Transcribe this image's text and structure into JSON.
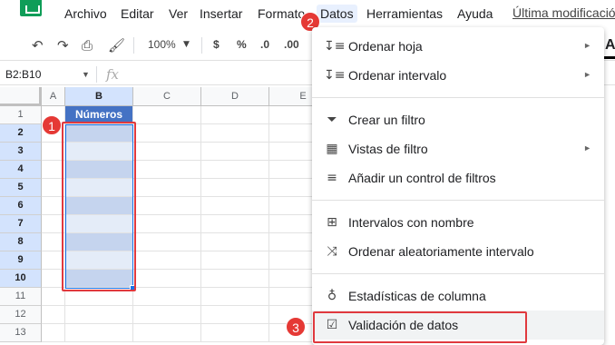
{
  "menubar": {
    "items": [
      "Archivo",
      "Editar",
      "Ver",
      "Insertar",
      "Formato",
      "Datos",
      "Herramientas",
      "Ayuda"
    ],
    "active": "Datos",
    "last_edit": "Última modificación"
  },
  "toolbar": {
    "zoom": "100%",
    "currency": "$",
    "percent": "%",
    "decimal_decrease": ".0",
    "decimal_increase": ".00",
    "text_color_label": "A"
  },
  "formula_bar": {
    "name_box": "B2:B10",
    "fx_label": "fx",
    "value": ""
  },
  "sheet": {
    "columns": [
      "A",
      "B",
      "C",
      "D",
      "E"
    ],
    "rows": [
      "1",
      "2",
      "3",
      "4",
      "5",
      "6",
      "7",
      "8",
      "9",
      "10",
      "11",
      "12",
      "13"
    ],
    "header_cell": "Números",
    "selected_range": "B2:B10",
    "header_color": "#4472c4",
    "band_dark": "#c5d4ee",
    "band_light": "#e4ecf8"
  },
  "datos_menu": {
    "items": [
      {
        "label": "Ordenar hoja",
        "icon": "sort-icon",
        "submenu": true
      },
      {
        "label": "Ordenar intervalo",
        "icon": "sort-icon",
        "submenu": true
      },
      {
        "label": "Crear un filtro",
        "icon": "filter-icon",
        "submenu": false
      },
      {
        "label": "Vistas de filtro",
        "icon": "filter-views-icon",
        "submenu": true
      },
      {
        "label": "Añadir un control de filtros",
        "icon": "slicer-icon",
        "submenu": false
      },
      {
        "label": "Intervalos con nombre",
        "icon": "named-ranges-icon",
        "submenu": false
      },
      {
        "label": "Ordenar aleatoriamente intervalo",
        "icon": "shuffle-icon",
        "submenu": false
      },
      {
        "label": "Estadísticas de columna",
        "icon": "lightbulb-icon",
        "submenu": false
      },
      {
        "label": "Validación de datos",
        "icon": "data-validation-icon",
        "submenu": false
      }
    ]
  },
  "annotations": {
    "step1": "1",
    "step2": "2",
    "step3": "3",
    "highlight_color": "#e0393e"
  }
}
